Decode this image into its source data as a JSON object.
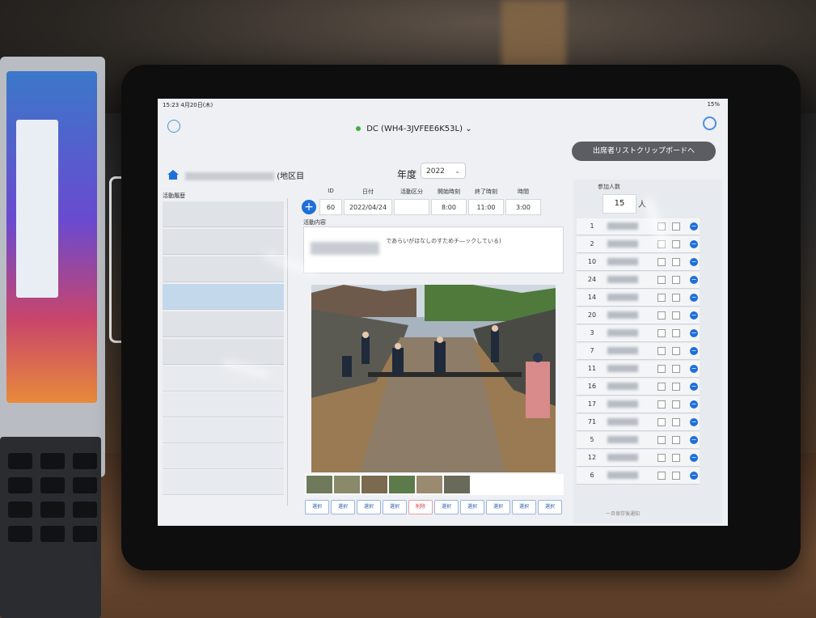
{
  "status_bar": {
    "time": "15:23 4月20日(木)",
    "battery": "15%"
  },
  "header": {
    "device_name": "DC (WH4-3JVFEE6K53L)",
    "device_chevron": "⌄",
    "clipboard_button": "出席者リストクリップボードへ",
    "org_suffix": "(地区目"
  },
  "year": {
    "label": "年度",
    "value": "2022"
  },
  "left_panel": {
    "title": "活動履歴"
  },
  "record": {
    "headers": [
      "ID",
      "日付",
      "活動区分",
      "開始時刻",
      "終了時刻",
      "時間"
    ],
    "values": [
      "60",
      "2022/04/24",
      "",
      "8:00",
      "11:00",
      "3:00"
    ],
    "activity_label": "活動内容",
    "activity_text": "であらいがほなしのすためチ―ックしている)"
  },
  "action_buttons": [
    "選択",
    "選択",
    "選択",
    "選択",
    "削除",
    "選択",
    "選択",
    "選択",
    "選択",
    "選択"
  ],
  "right_panel": {
    "header": "参加人数",
    "count": "15",
    "unit": "人",
    "participant_ids": [
      "1",
      "2",
      "10",
      "24",
      "14",
      "20",
      "3",
      "7",
      "11",
      "16",
      "17",
      "71",
      "5",
      "12",
      "6"
    ],
    "footer": "一旦保存後通知"
  },
  "icons": {
    "home": "home-icon",
    "search": "search-icon",
    "add": "plus-icon",
    "remove": "minus-icon"
  },
  "colors": {
    "accent": "#1e6fd9",
    "clip_button_bg": "#5b5d63",
    "selected_row": "#c4d8ec"
  }
}
